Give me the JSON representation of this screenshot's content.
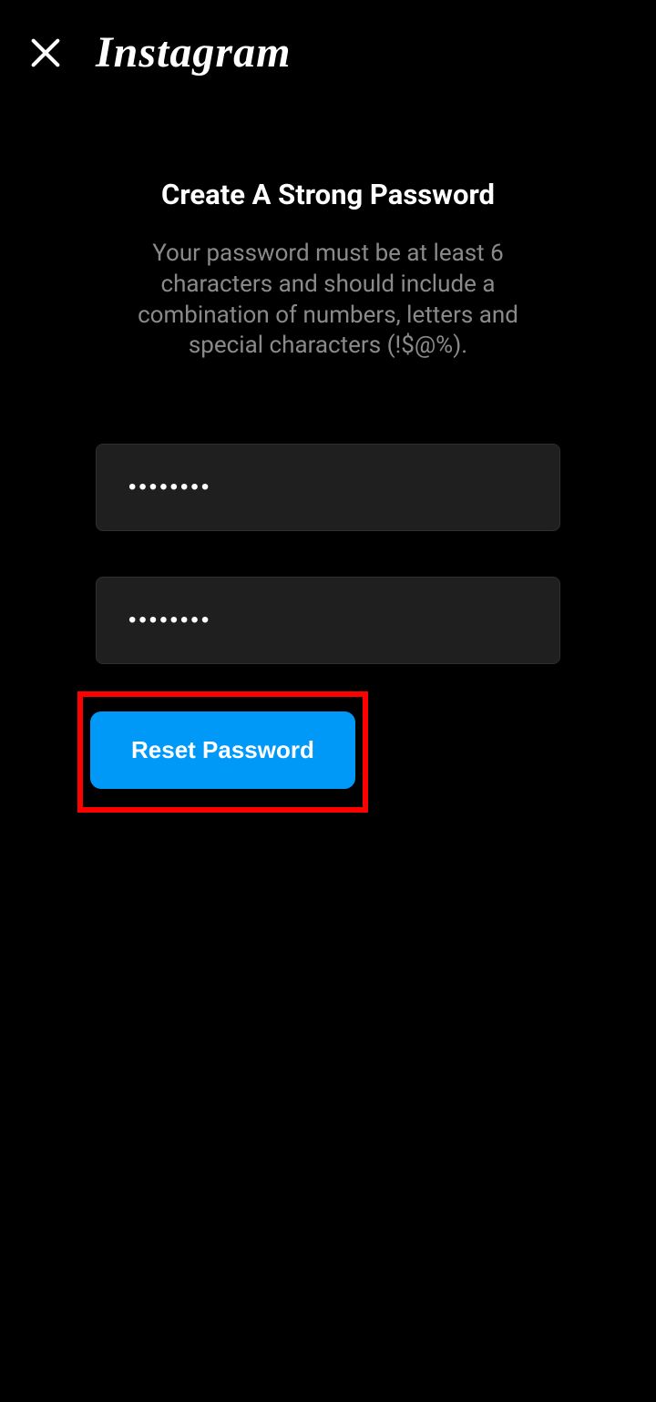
{
  "header": {
    "brand": "Instagram"
  },
  "main": {
    "title": "Create A Strong Password",
    "subtitle": "Your password must be at least 6 characters and should include a combination of numbers, letters and special characters (!$@%).",
    "password_value": "••••••••",
    "confirm_value": "••••••••",
    "reset_button_label": "Reset Password"
  }
}
